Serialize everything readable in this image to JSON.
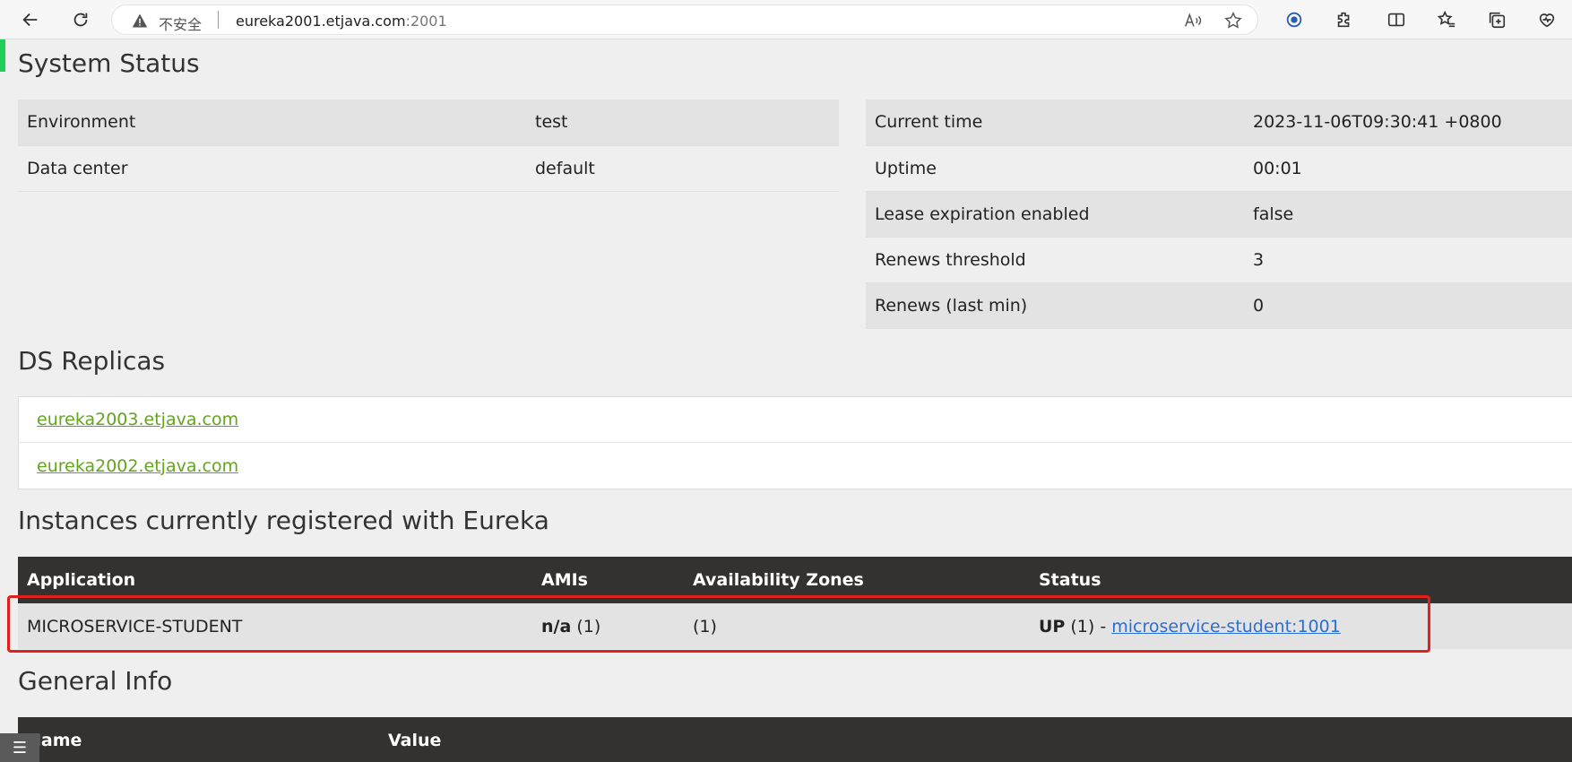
{
  "browser": {
    "insecure_label": "不安全",
    "url_host": "eureka2001.etjava.com",
    "url_port": ":2001"
  },
  "system_status": {
    "title": "System Status",
    "left": [
      {
        "label": "Environment",
        "value": "test"
      },
      {
        "label": "Data center",
        "value": "default"
      }
    ],
    "right": [
      {
        "label": "Current time",
        "value": "2023-11-06T09:30:41 +0800"
      },
      {
        "label": "Uptime",
        "value": "00:01"
      },
      {
        "label": "Lease expiration enabled",
        "value": "false"
      },
      {
        "label": "Renews threshold",
        "value": "3"
      },
      {
        "label": "Renews (last min)",
        "value": "0"
      }
    ]
  },
  "ds_replicas": {
    "title": "DS Replicas",
    "items": [
      "eureka2003.etjava.com",
      "eureka2002.etjava.com"
    ]
  },
  "instances": {
    "title": "Instances currently registered with Eureka",
    "headers": [
      "Application",
      "AMIs",
      "Availability Zones",
      "Status"
    ],
    "rows": [
      {
        "application": "MICROSERVICE-STUDENT",
        "amis_bold": "n/a",
        "amis_count": " (1)",
        "zones": "(1)",
        "status_bold": "UP",
        "status_count": " (1) - ",
        "status_link": "microservice-student:1001"
      }
    ]
  },
  "general_info": {
    "title": "General Info",
    "headers": [
      "Name",
      "Value"
    ]
  },
  "colors": {
    "header_bg": "#343230",
    "link_green": "#63a41f",
    "link_blue": "#2a6fd4",
    "highlight_red": "#e0201b"
  }
}
